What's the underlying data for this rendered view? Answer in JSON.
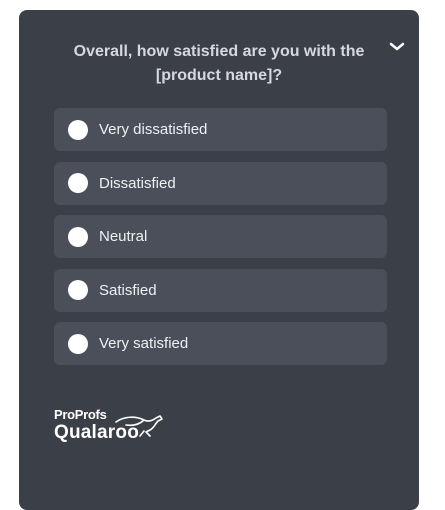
{
  "survey": {
    "question": "Overall, how satisfied are you with the [product name]?",
    "collapse_icon": "chevron-down-icon",
    "options": [
      {
        "label": "Very dissatisfied"
      },
      {
        "label": "Dissatisfied"
      },
      {
        "label": "Neutral"
      },
      {
        "label": "Satisfied"
      },
      {
        "label": "Very satisfied"
      }
    ]
  },
  "branding": {
    "line1": "ProProfs",
    "line2": "Qualaroo",
    "icon": "kangaroo-icon"
  },
  "colors": {
    "panel": "#3b3f48",
    "option_bg": "#4a4f5a",
    "text": "#eef0f3",
    "radio": "#ffffff"
  }
}
